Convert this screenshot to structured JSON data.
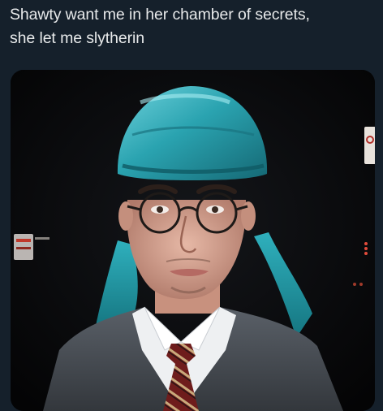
{
  "tweet": {
    "text_lines": [
      "Shawty want me in her chamber of secrets,",
      "she let me slytherin"
    ]
  },
  "media": {
    "kind": "photo",
    "subject": "person-portrait",
    "colors": {
      "background": "#15202b",
      "text": "#e7e9ea",
      "durag": "#2aa3b0",
      "sweater": "#4b5057",
      "tie_red": "#7a1f1f"
    }
  }
}
